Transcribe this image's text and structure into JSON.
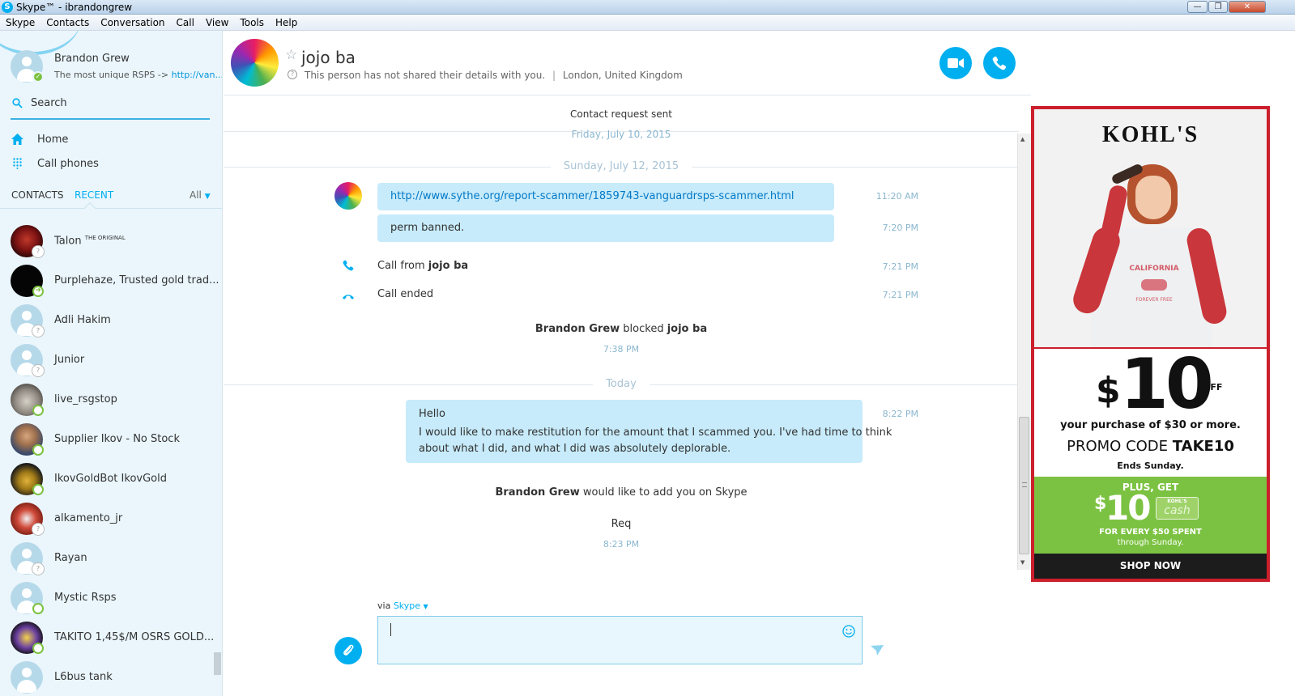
{
  "window": {
    "title": "Skype™ - ibrandongrew",
    "logo_glyph": "S",
    "minimize_glyph": "—",
    "maximize_glyph": "❐",
    "close_glyph": "✕"
  },
  "menubar": [
    "Skype",
    "Contacts",
    "Conversation",
    "Call",
    "View",
    "Tools",
    "Help"
  ],
  "profile": {
    "name": "Brandon Grew",
    "mood_prefix": "The most unique RSPS ->",
    "mood_link": "http://van...",
    "status": "online"
  },
  "sidebar": {
    "search_label": "Search",
    "nav": [
      {
        "label": "Home",
        "icon": "home-icon"
      },
      {
        "label": "Call phones",
        "icon": "dialpad-icon"
      }
    ],
    "tabs": {
      "contacts": "CONTACTS",
      "recent": "RECENT",
      "filter": "All"
    },
    "contacts": [
      {
        "name": "Talon",
        "suffix": "THE ORIGINAL",
        "presence": "unknown",
        "avatar": "bull"
      },
      {
        "name": "Purplehaze, Trusted gold trad...",
        "presence": "forwarded",
        "avatar": "dark"
      },
      {
        "name": "Adli Hakim",
        "presence": "unknown",
        "avatar": "generic"
      },
      {
        "name": "Junior",
        "presence": "unknown",
        "avatar": "generic"
      },
      {
        "name": "live_rsgstop",
        "presence": "online",
        "avatar": "koala"
      },
      {
        "name": "Supplier Ikov - No Stock",
        "presence": "online",
        "avatar": "man"
      },
      {
        "name": "IkovGoldBot IkovGold",
        "presence": "online",
        "avatar": "gold"
      },
      {
        "name": "alkamento_jr",
        "presence": "unknown",
        "avatar": "red"
      },
      {
        "name": "Rayan",
        "presence": "unknown",
        "avatar": "generic"
      },
      {
        "name": "Mystic Rsps",
        "presence": "online",
        "avatar": "generic"
      },
      {
        "name": "TAKITO 1,45$/M OSRS GOLD...",
        "presence": "online",
        "avatar": "takito"
      },
      {
        "name": "L6bus tank",
        "presence": "unknown",
        "avatar": "generic"
      }
    ]
  },
  "chat_header": {
    "contact_name": "jojo ba",
    "info": "This person has not shared their details with you.",
    "location": "London, United Kingdom",
    "contact_request": "Contact request sent"
  },
  "conversation": {
    "top_date_cut": "Friday, July 10, 2015",
    "date1": "Sunday, July 12, 2015",
    "msg_link": "http://www.sythe.org/report-scammer/1859743-vanguardrsps-scammer.html",
    "msg_link_time": "11:20 AM",
    "msg2": "perm banned.",
    "msg2_time": "7:20 PM",
    "call_from_prefix": "Call from ",
    "call_from_name": "jojo ba",
    "call_from_time": "7:21 PM",
    "call_ended": "Call ended",
    "call_ended_time": "7:21 PM",
    "blocked_actor": "Brandon Grew",
    "blocked_verb": " blocked ",
    "blocked_target": "jojo ba",
    "blocked_time": "7:38 PM",
    "date2": "Today",
    "hello_line1": "Hello",
    "hello_line2": "I would like to make restitution for the amount that I scammed you. I've had time to think",
    "hello_line3": "about what I did, and what I did was absolutely deplorable.",
    "hello_time": "8:22 PM",
    "add_actor": "Brandon Grew",
    "add_text": " would like to add you on Skype",
    "req": "Req",
    "req_time": "8:23 PM"
  },
  "composer": {
    "via_label": "via",
    "via_service": "Skype"
  },
  "ad": {
    "brand": "KOHL'S",
    "shirt_text": "CALIFORNIA",
    "shirt_small": "FOREVER FREE",
    "dollar": "$",
    "amount": "10",
    "off": "OFF",
    "purchase": "your purchase of $30 or more.",
    "promo_prefix": "PROMO CODE ",
    "promo_code": "TAKE10",
    "ends": "Ends Sunday.",
    "plus": "PLUS, GET",
    "cash_amount": "10",
    "cash_top": "KOHL'S",
    "cash_word": "cash",
    "every": "FOR EVERY $50 SPENT",
    "through": "through Sunday.",
    "shop": "SHOP NOW",
    "colors": {
      "red": "#cc1f2c",
      "green": "#7cc242",
      "black": "#1c1c1c"
    }
  },
  "colors": {
    "accent": "#00aff0",
    "bubble": "#c7ebfa",
    "sidebar": "#eaf6fc"
  }
}
